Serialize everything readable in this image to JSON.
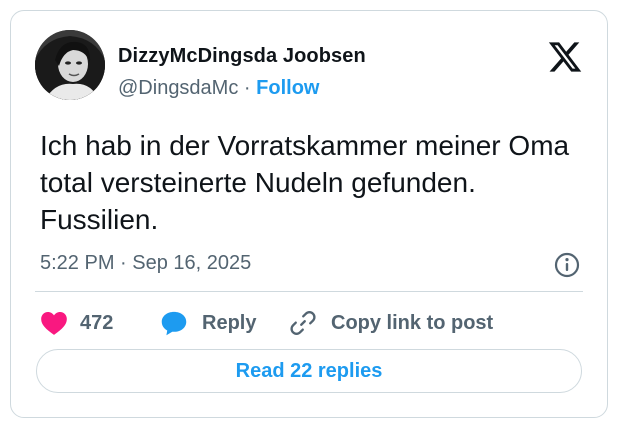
{
  "author": {
    "display_name": "DizzyMcDingsda Joobsen",
    "handle": "@DingsdaMc",
    "separator": "·",
    "follow_label": "Follow"
  },
  "tweet": {
    "text": "Ich hab in der Vorratskammer meiner Oma total versteinerte Nudeln gefunden. Fussilien.",
    "timestamp": "5:22 PM · Sep 16, 2025"
  },
  "actions": {
    "like_count": "472",
    "reply_label": "Reply",
    "copy_link_label": "Copy link to post"
  },
  "read_replies_label": "Read 22 replies",
  "icons": {
    "logo": "x-logo-icon",
    "info": "info-icon",
    "like": "heart-icon",
    "reply": "speech-bubble-icon",
    "copy": "link-icon"
  },
  "colors": {
    "accent": "#1d9bf0",
    "heart": "#f91880",
    "secondary_text": "#536471",
    "border": "#cfd9de"
  }
}
